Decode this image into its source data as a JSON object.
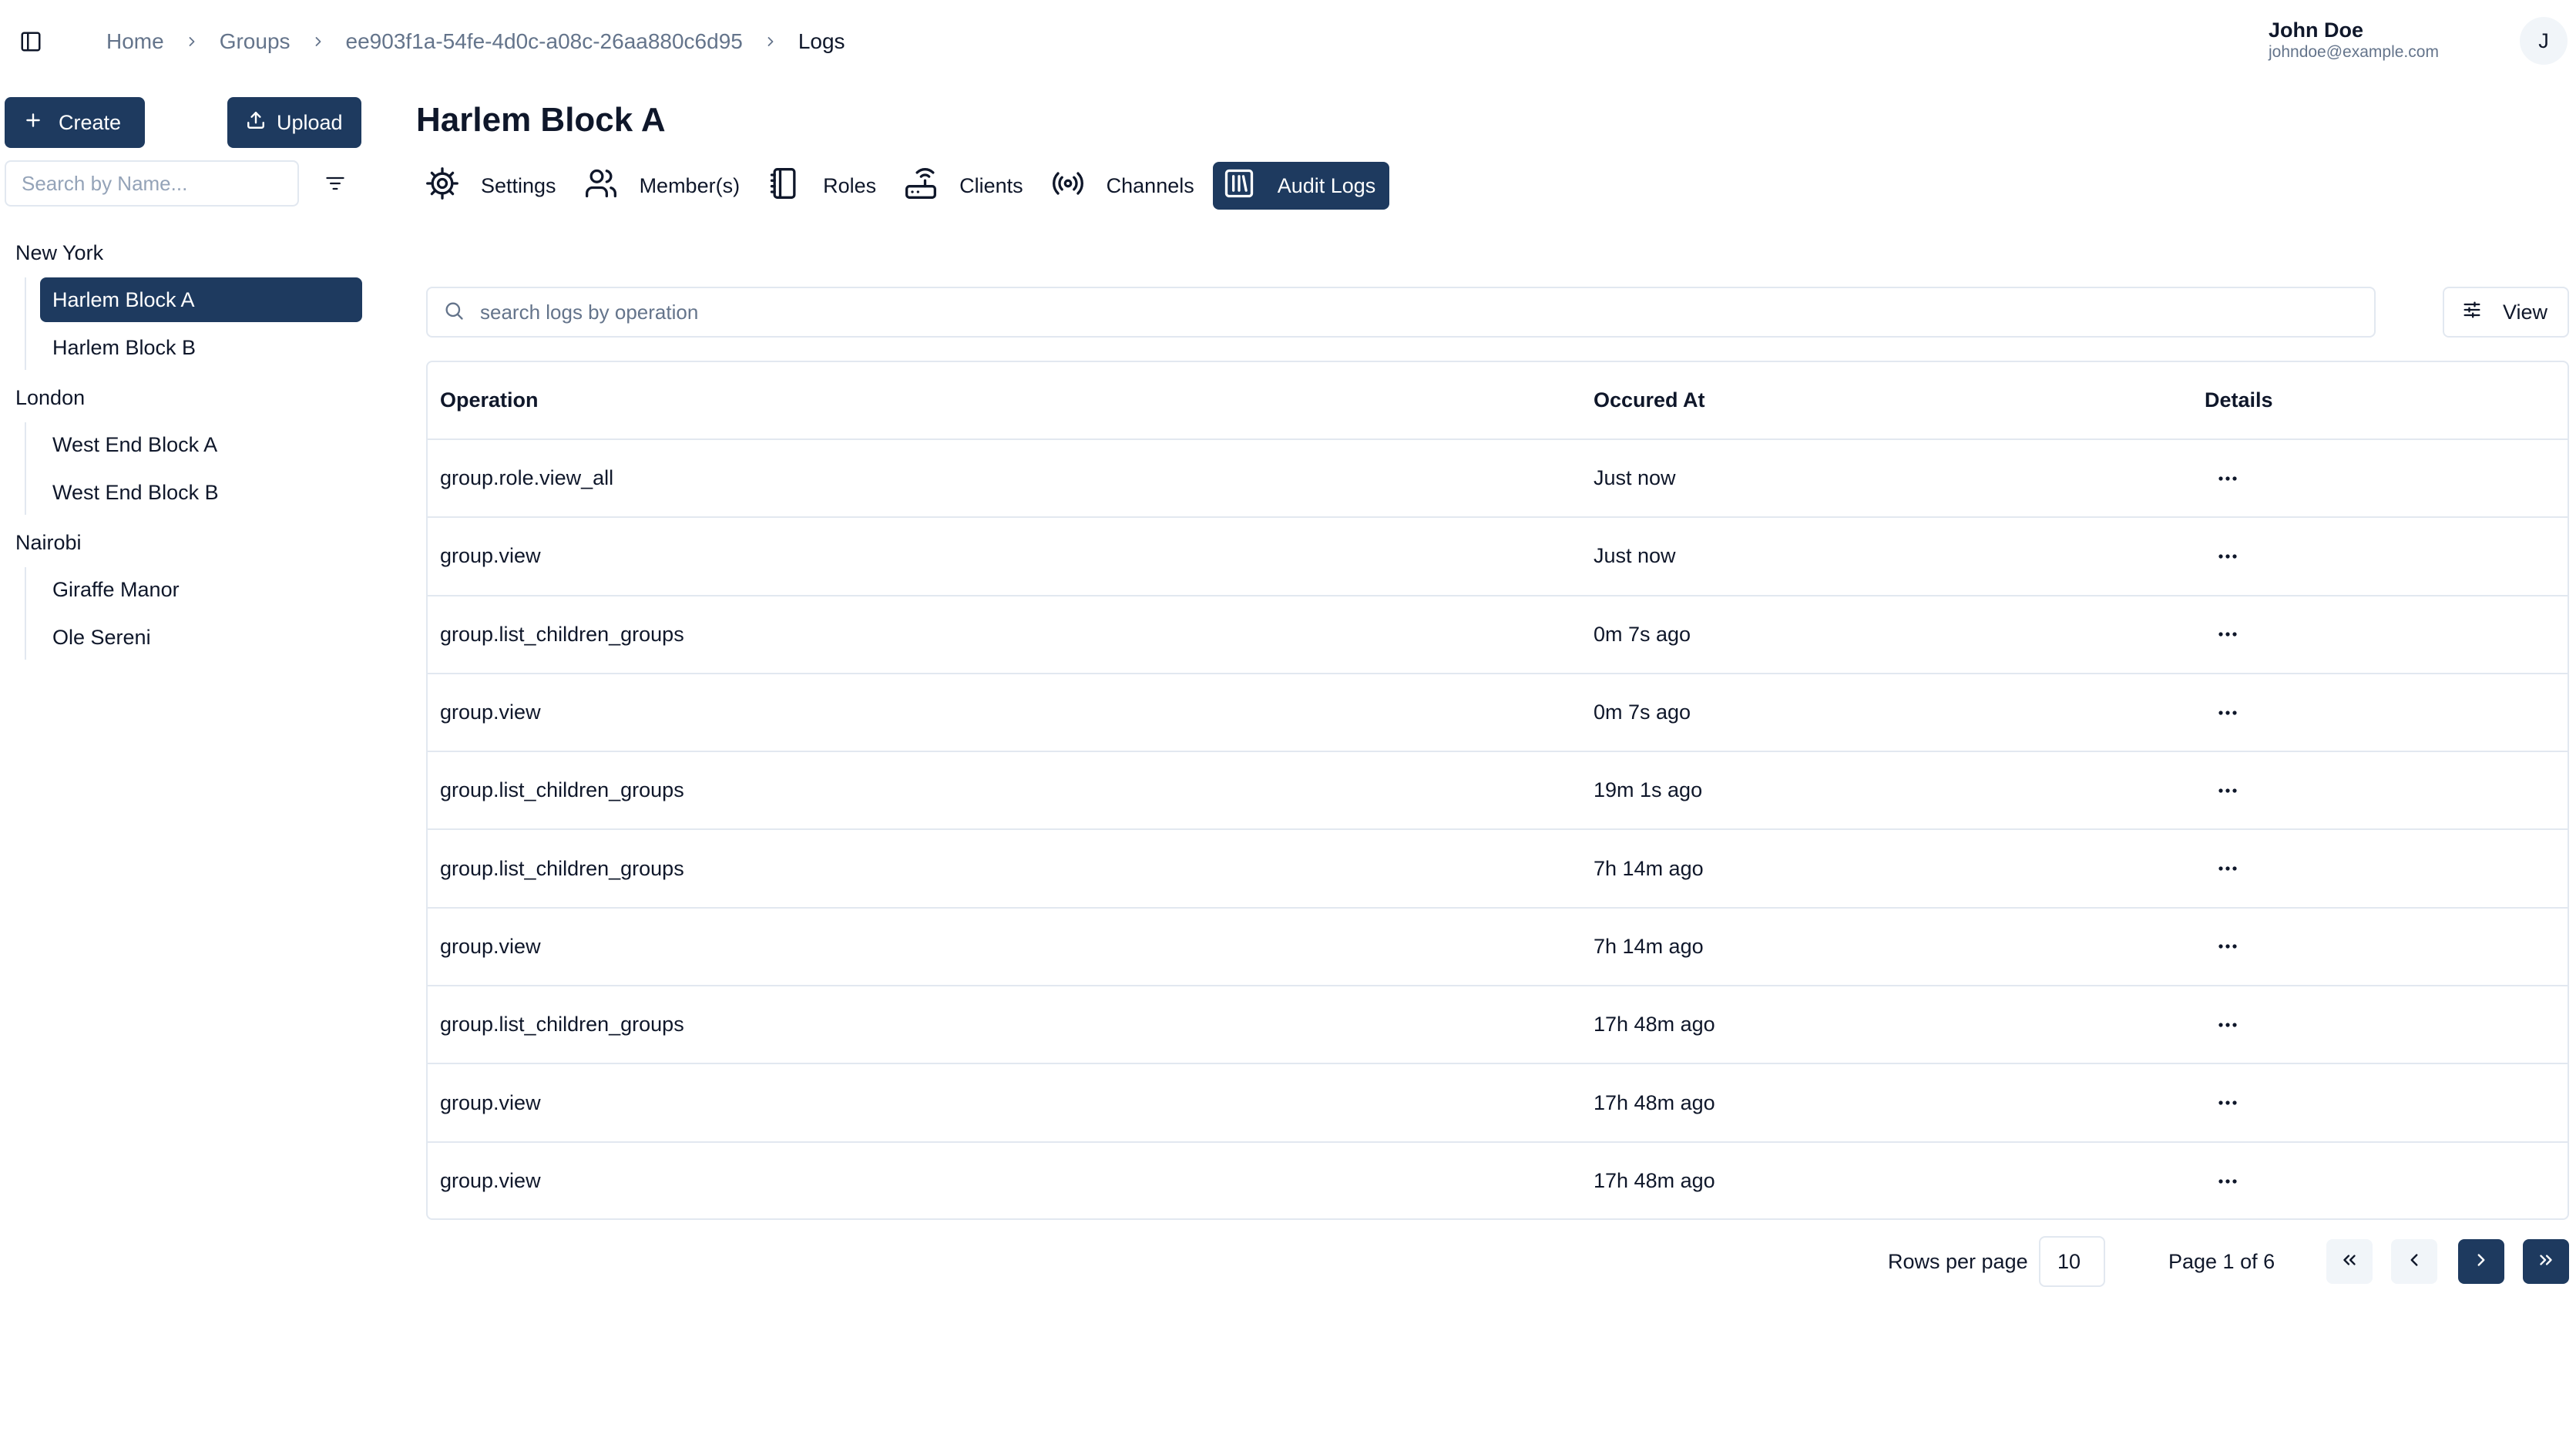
{
  "breadcrumb": [
    "Home",
    "Groups",
    "ee903f1a-54fe-4d0c-a08c-26aa880c6d95",
    "Logs"
  ],
  "user": {
    "name": "John Doe",
    "email": "johndoe@example.com",
    "initial": "J"
  },
  "sidebar": {
    "create_label": "Create",
    "upload_label": "Upload",
    "search_placeholder": "Search by Name...",
    "groups": [
      {
        "label": "New York",
        "children": [
          "Harlem Block A",
          "Harlem Block B"
        ]
      },
      {
        "label": "London",
        "children": [
          "West End Block A",
          "West End Block B"
        ]
      },
      {
        "label": "Nairobi",
        "children": [
          "Giraffe Manor",
          "Ole Sereni"
        ]
      }
    ],
    "active_item": "Harlem Block A"
  },
  "main": {
    "title": "Harlem Block A",
    "tabs": [
      {
        "label": "Settings",
        "icon": "gear-icon"
      },
      {
        "label": "Member(s)",
        "icon": "users-icon"
      },
      {
        "label": "Roles",
        "icon": "notebook-icon"
      },
      {
        "label": "Clients",
        "icon": "router-icon"
      },
      {
        "label": "Channels",
        "icon": "broadcast-icon"
      },
      {
        "label": "Audit Logs",
        "icon": "library-icon",
        "active": true
      }
    ],
    "search_placeholder": "search logs by operation",
    "view_label": "View"
  },
  "table": {
    "headers": [
      "Operation",
      "Occured At",
      "Details"
    ],
    "rows": [
      {
        "operation": "group.role.view_all",
        "occurred_at": "Just now"
      },
      {
        "operation": "group.view",
        "occurred_at": "Just now"
      },
      {
        "operation": "group.list_children_groups",
        "occurred_at": "0m 7s ago"
      },
      {
        "operation": "group.view",
        "occurred_at": "0m 7s ago"
      },
      {
        "operation": "group.list_children_groups",
        "occurred_at": "19m 1s ago"
      },
      {
        "operation": "group.list_children_groups",
        "occurred_at": "7h 14m ago"
      },
      {
        "operation": "group.view",
        "occurred_at": "7h 14m ago"
      },
      {
        "operation": "group.list_children_groups",
        "occurred_at": "17h 48m ago"
      },
      {
        "operation": "group.view",
        "occurred_at": "17h 48m ago"
      },
      {
        "operation": "group.view",
        "occurred_at": "17h 48m ago"
      }
    ]
  },
  "pagination": {
    "rows_per_page_label": "Rows per page",
    "rows_per_page": "10",
    "page_info": "Page 1 of 6"
  },
  "colors": {
    "primary": "#1e3a5f",
    "border": "#e2e8f0",
    "muted": "#64748b"
  }
}
